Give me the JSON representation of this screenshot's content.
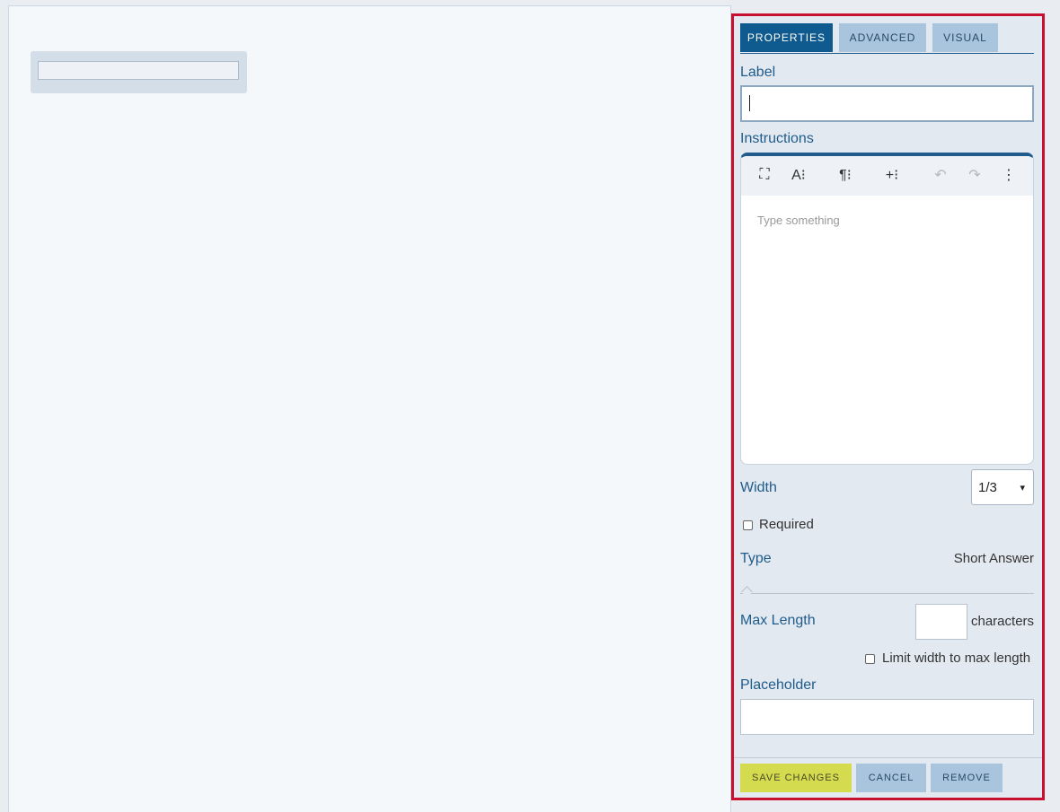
{
  "tabs": [
    {
      "label": "PROPERTIES"
    },
    {
      "label": "ADVANCED"
    },
    {
      "label": "VISUAL"
    }
  ],
  "label_section": {
    "title": "Label",
    "value": ""
  },
  "instructions": {
    "title": "Instructions",
    "placeholder": "Type something",
    "toolbar": {
      "fullscreen": "⛶",
      "font": "A⁝",
      "paragraph": "¶⁝",
      "insert": "+⁝",
      "undo": "↶",
      "redo": "↷",
      "more": "⋮"
    }
  },
  "width": {
    "label": "Width",
    "selected": "1/3",
    "chevron": "▾"
  },
  "required": {
    "label": "Required",
    "checked": false
  },
  "type": {
    "label": "Type",
    "value": "Short Answer"
  },
  "max_length": {
    "label": "Max Length",
    "value": "",
    "suffix": "characters"
  },
  "limit_width": {
    "label": "Limit width to max length",
    "checked": false
  },
  "placeholder_section": {
    "title": "Placeholder",
    "value": ""
  },
  "footer": {
    "save": "SAVE CHANGES",
    "cancel": "CANCEL",
    "remove": "REMOVE"
  },
  "colors": {
    "accent": "#0f5a8f",
    "panel_border": "#c8102e",
    "save_button": "#d4db4f",
    "tab_inactive": "#a9c4dd"
  }
}
